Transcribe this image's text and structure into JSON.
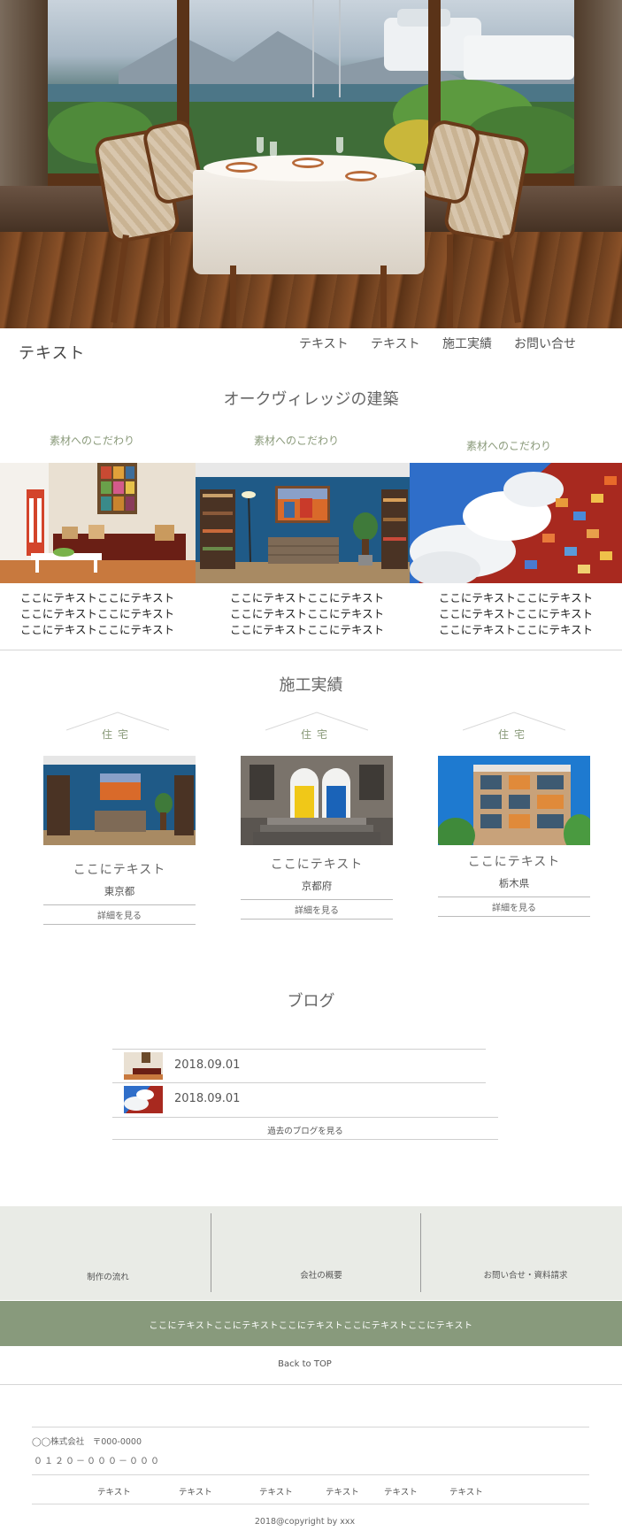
{
  "header": {
    "site_title": "テキスト",
    "nav": [
      "テキスト",
      "テキスト",
      "施工実績",
      "お問い合せ"
    ]
  },
  "concept": {
    "title": "オークヴィレッジの建築",
    "features": [
      {
        "label": "素材へのこだわり",
        "lines": [
          "ここにテキストここにテキスト",
          "ここにテキストここにテキスト",
          "ここにテキストここにテキスト"
        ]
      },
      {
        "label": "素材へのこだわり",
        "lines": [
          "ここにテキストここにテキスト",
          "ここにテキストここにテキスト",
          "ここにテキストここにテキスト"
        ]
      },
      {
        "label": "素材へのこだわり",
        "lines": [
          "ここにテキストここにテキスト",
          "ここにテキストここにテキスト",
          "ここにテキストここにテキスト"
        ]
      }
    ]
  },
  "works": {
    "title": "施工実績",
    "items": [
      {
        "tag": "住宅",
        "title": "ここにテキスト",
        "location": "東京都",
        "detail_label": "詳細を見る"
      },
      {
        "tag": "住宅",
        "title": "ここにテキスト",
        "location": "京都府",
        "detail_label": "詳細を見る"
      },
      {
        "tag": "住宅",
        "title": "ここにテキスト",
        "location": "栃木県",
        "detail_label": "詳細を見る"
      }
    ]
  },
  "blog": {
    "title": "ブログ",
    "entries": [
      {
        "date": "2018.09.01"
      },
      {
        "date": "2018.09.01"
      }
    ],
    "more_label": "過去のブログを見る"
  },
  "footer": {
    "links": [
      "制作の流れ",
      "会社の概要",
      "お問い合せ・資料請求"
    ],
    "band_text": "ここにテキストここにテキストここにテキストここにテキストここにテキスト",
    "back_to_top": "Back to TOP",
    "company": "◯◯株式会社　〒000-0000",
    "phone": "０１２０－０００－０００",
    "bottom_nav": [
      "テキスト",
      "テキスト",
      "テキスト",
      "テキスト",
      "テキスト",
      "テキスト"
    ],
    "copyright": "2018@copyright by xxx"
  },
  "colors": {
    "accent_green": "#889a7c",
    "label_green": "#8a9a7a",
    "footer_bg": "#e9ebe6"
  }
}
